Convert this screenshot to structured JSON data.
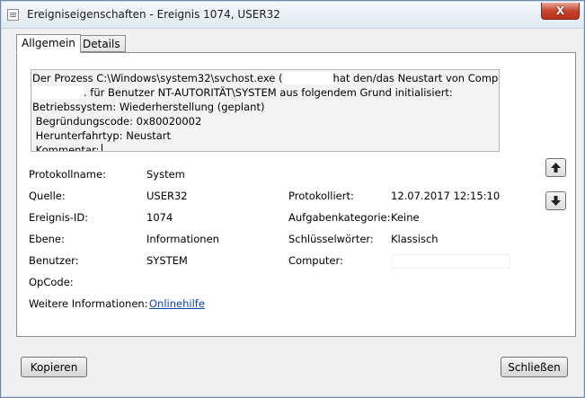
{
  "window": {
    "title": "Ereigniseigenschaften - Ereignis 1074, USER32",
    "close_label": "X",
    "accent_close": "#c7442f"
  },
  "tabs": [
    {
      "label": "Allgemein",
      "selected": true
    },
    {
      "label": "Details",
      "selected": false
    }
  ],
  "description": {
    "line1_a": "Der Prozess C:\\Windows\\system32\\svchost.exe (",
    "line1_b": "hat den/das Neustart von Computer",
    "line2_b": ". für Benutzer NT-AUTORITÄT\\SYSTEM aus folgendem Grund initialisiert:",
    "line3": "Betriebssystem: Wiederherstellung (geplant)",
    "line4": " Begründungscode: 0x80020002",
    "line5": " Herunterfahrtyp: Neustart",
    "line6": " Kommentar:"
  },
  "fields": {
    "protokollname": {
      "label": "Protokollname:",
      "value": "System"
    },
    "quelle": {
      "label": "Quelle:",
      "value": "USER32"
    },
    "protokolliert": {
      "label": "Protokolliert:",
      "value": "12.07.2017 12:15:10"
    },
    "ereignis_id": {
      "label": "Ereignis-ID:",
      "value": "1074"
    },
    "aufgabenkategorie": {
      "label": "Aufgabenkategorie:",
      "value": "Keine"
    },
    "ebene": {
      "label": "Ebene:",
      "value": "Informationen"
    },
    "schluesselwoerter": {
      "label": "Schlüsselwörter:",
      "value": "Klassisch"
    },
    "benutzer": {
      "label": "Benutzer:",
      "value": "SYSTEM"
    },
    "computer": {
      "label": "Computer:",
      "value": ""
    },
    "opcode": {
      "label": "OpCode:",
      "value": ""
    },
    "weitere": {
      "label": "Weitere Informationen:",
      "link": "Onlinehilfe"
    }
  },
  "buttons": {
    "copy": "Kopieren",
    "close": "Schließen"
  },
  "nav_icons": {
    "up": "arrow-up-icon",
    "down": "arrow-down-icon"
  }
}
